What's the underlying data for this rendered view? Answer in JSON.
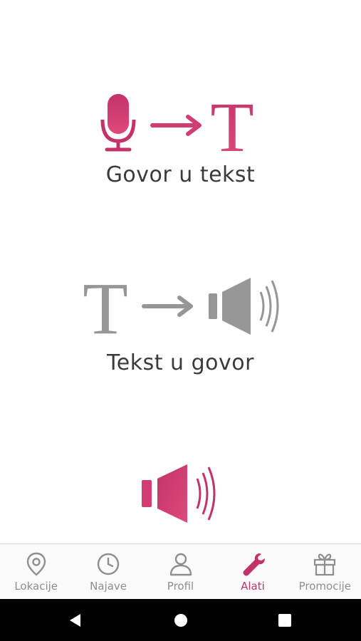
{
  "colors": {
    "accent": "#c3336a",
    "accent_light": "#e0497a",
    "gray_icon": "#969696",
    "label": "#3a3a3a",
    "nav_inactive": "#8e8e8e"
  },
  "tools": [
    {
      "label": "Govor u tekst",
      "icon": "mic-to-text-icon"
    },
    {
      "label": "Tekst u govor",
      "icon": "text-to-speaker-icon"
    },
    {
      "label": "",
      "icon": "speaker-icon"
    }
  ],
  "glyphs": {
    "text_letter": "T"
  },
  "nav": {
    "items": [
      {
        "label": "Lokacije",
        "icon": "location-pin-icon"
      },
      {
        "label": "Najave",
        "icon": "clock-icon"
      },
      {
        "label": "Profil",
        "icon": "user-icon"
      },
      {
        "label": "Alati",
        "icon": "wrench-icon",
        "active": true
      },
      {
        "label": "Promocije",
        "icon": "gift-icon"
      }
    ]
  },
  "system_bar": {
    "buttons": [
      "back",
      "home",
      "recents"
    ]
  }
}
